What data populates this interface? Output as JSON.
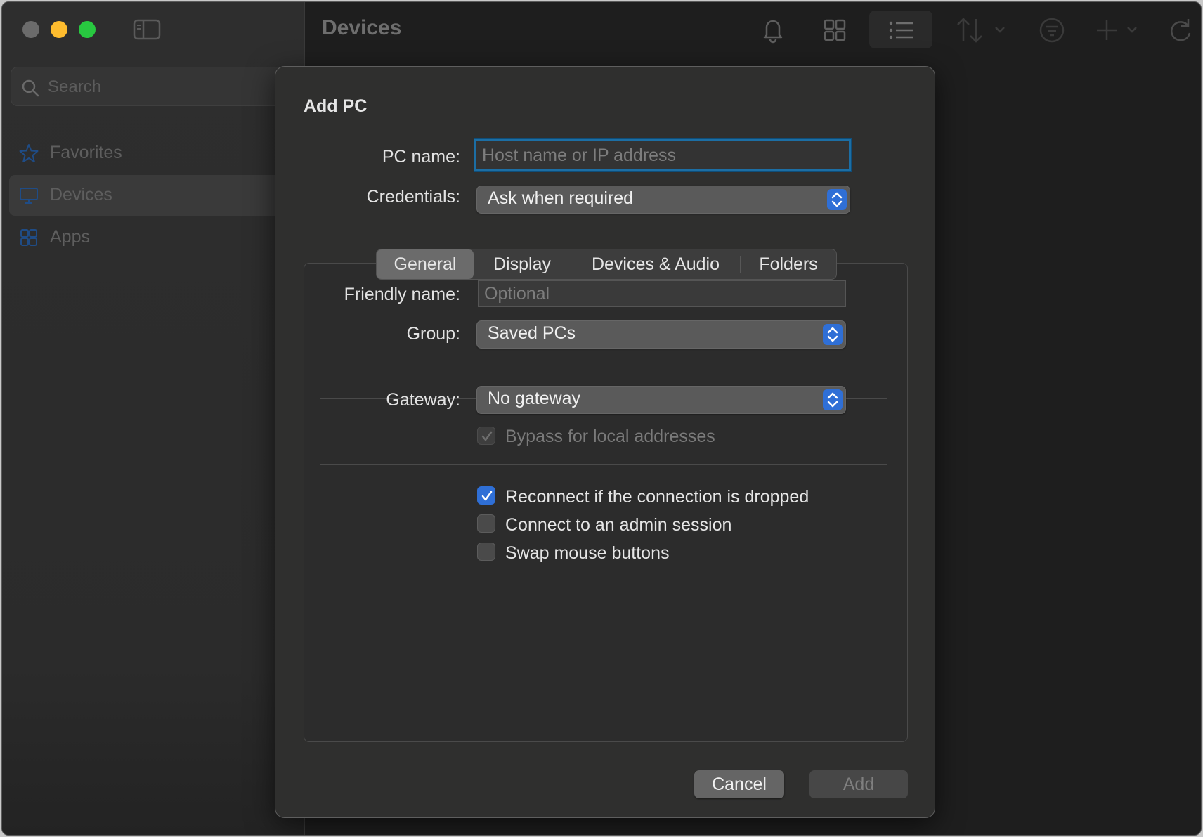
{
  "window": {
    "title": "Devices"
  },
  "sidebar": {
    "search_placeholder": "Search",
    "items": [
      {
        "label": "Favorites",
        "icon": "star-icon"
      },
      {
        "label": "Devices",
        "icon": "monitor-icon",
        "active": true
      },
      {
        "label": "Apps",
        "icon": "apps-grid-icon"
      }
    ]
  },
  "toolbar": {
    "icons": [
      "bell-icon",
      "grid-view-icon",
      "list-view-icon",
      "sort-icon",
      "filter-icon",
      "add-icon",
      "refresh-icon"
    ]
  },
  "dialog": {
    "title": "Add PC",
    "pc_name_label": "PC name:",
    "pc_name_placeholder": "Host name or IP address",
    "credentials_label": "Credentials:",
    "credentials_value": "Ask when required",
    "tabs": [
      "General",
      "Display",
      "Devices & Audio",
      "Folders"
    ],
    "active_tab": "General",
    "friendly_name_label": "Friendly name:",
    "friendly_name_placeholder": "Optional",
    "group_label": "Group:",
    "group_value": "Saved PCs",
    "gateway_label": "Gateway:",
    "gateway_value": "No gateway",
    "bypass_label": "Bypass for local addresses",
    "options": [
      {
        "label": "Reconnect if the connection is dropped",
        "checked": true
      },
      {
        "label": "Connect to an admin session",
        "checked": false
      },
      {
        "label": "Swap mouse buttons",
        "checked": false
      }
    ],
    "cancel_label": "Cancel",
    "add_label": "Add"
  },
  "colors": {
    "accent": "#2f6fd6",
    "focus_ring": "#1c6ea4",
    "traffic_minimize": "#febc2e",
    "traffic_maximize": "#28c840"
  }
}
